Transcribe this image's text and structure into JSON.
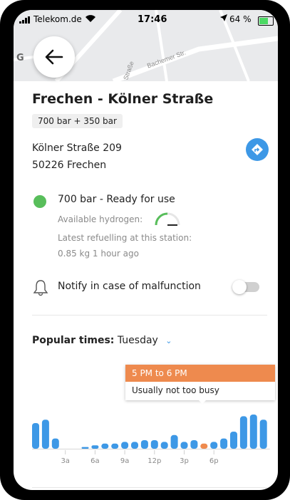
{
  "status_bar": {
    "carrier": "Telekom.de",
    "time": "17:46",
    "battery": "64 %",
    "icons": [
      "signal-icon",
      "wifi-icon",
      "location-arrow-icon",
      "battery-charging-icon"
    ]
  },
  "map": {
    "logo": "G",
    "street_label": "Bachemer Str.",
    "street_label_2": "Straße"
  },
  "station": {
    "name": "Frechen - Kölner Straße",
    "pressure": "700 bar + 350 bar",
    "address_line1": "Kölner Straße 209",
    "address_line2": "50226 Frechen",
    "status": "700 bar - Ready for use",
    "status_color": "#58be5b",
    "available_label": "Available hydrogen:",
    "available_level": 0.5,
    "refuel_label": "Latest refuelling at this station:",
    "refuel_value": "0.85 kg 1 hour ago"
  },
  "notify": {
    "label": "Notify in case of malfunction",
    "enabled": false
  },
  "popular": {
    "label": "Popular times:",
    "day": "Tuesday"
  },
  "tooltip": {
    "time": "5 PM to 6 PM",
    "text": "Usually not too busy"
  },
  "colors": {
    "accent": "#3d98e6",
    "highlight": "#ee8a4e",
    "ready": "#58be5b"
  },
  "chart_data": {
    "type": "bar",
    "categories": [
      "0",
      "1",
      "2",
      "3",
      "4",
      "5",
      "6",
      "7",
      "8",
      "9",
      "10",
      "11",
      "12",
      "13",
      "14",
      "15",
      "16",
      "17",
      "18",
      "19",
      "20",
      "21",
      "22",
      "23"
    ],
    "values": [
      15,
      17,
      6,
      0,
      0,
      1,
      2,
      3,
      3,
      4,
      4,
      5,
      5,
      4,
      8,
      4,
      5,
      3,
      4,
      6,
      10,
      19,
      20,
      17
    ],
    "highlight_index": 17,
    "tick_labels": [
      {
        "index": 3,
        "label": "3a"
      },
      {
        "index": 6,
        "label": "6a"
      },
      {
        "index": 9,
        "label": "9a"
      },
      {
        "index": 12,
        "label": "12p"
      },
      {
        "index": 15,
        "label": "3p"
      },
      {
        "index": 18,
        "label": "6p"
      }
    ],
    "ylim": [
      0,
      20
    ]
  }
}
